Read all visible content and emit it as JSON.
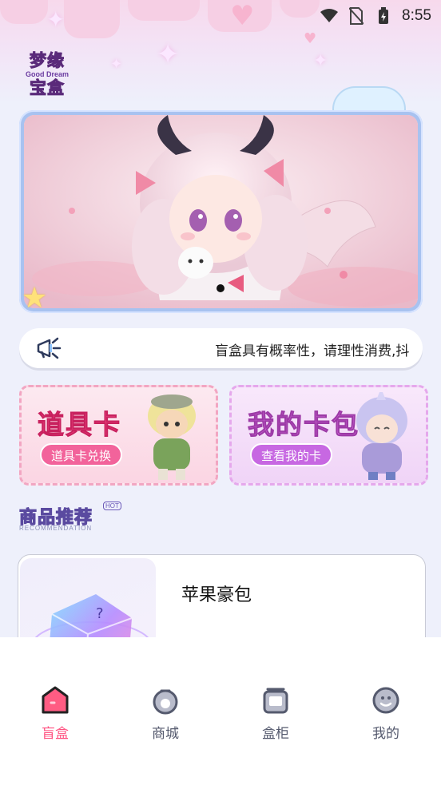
{
  "status_bar": {
    "time": "8:55"
  },
  "logo": {
    "line1": "梦缘",
    "sub": "Good Dream",
    "line2": "宝盒"
  },
  "notice": {
    "text": "盲盒具有概率性，请理性消费,抖"
  },
  "cards": [
    {
      "title": "道具卡",
      "button": "道具卡兑换"
    },
    {
      "title": "我的卡包",
      "button": "查看我的卡"
    }
  ],
  "section": {
    "title": "商品推荐",
    "hot": "HOT",
    "subtitle": "RECOMMENDATION"
  },
  "product": {
    "name": "苹果豪包"
  },
  "bottom_nav": [
    {
      "label": "盲盒",
      "icon": "blindbox-icon",
      "active": true
    },
    {
      "label": "商城",
      "icon": "shop-bag-icon",
      "active": false
    },
    {
      "label": "盒柜",
      "icon": "cabinet-icon",
      "active": false
    },
    {
      "label": "我的",
      "icon": "profile-icon",
      "active": false
    }
  ],
  "colors": {
    "accent": "#ff4f7f",
    "nav_inactive": "#555a6e"
  }
}
